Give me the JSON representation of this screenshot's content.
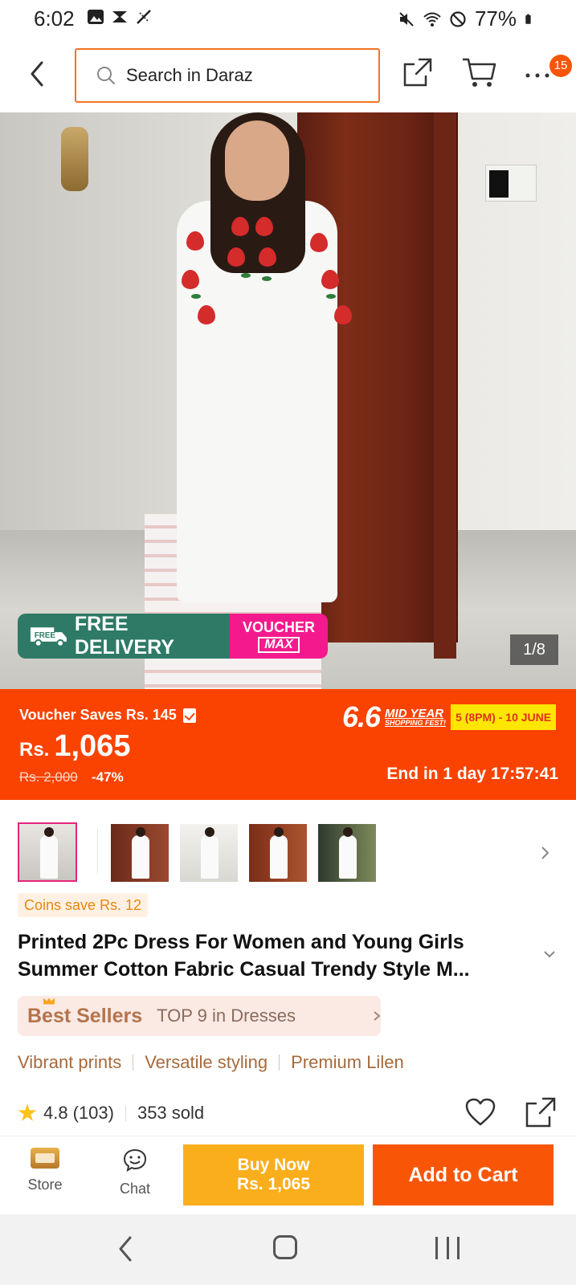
{
  "status_bar": {
    "time": "6:02",
    "battery": "77%",
    "icons": [
      "image-icon",
      "media-icon",
      "no-signal-icon",
      "mute-icon",
      "wifi-icon",
      "dnd-icon",
      "battery-icon"
    ]
  },
  "header": {
    "search_placeholder": "Search in Daraz",
    "notification_count": "15",
    "accent_color": "#f57224"
  },
  "gallery": {
    "counter": "1/8",
    "free_delivery": "FREE DELIVERY",
    "truck_label": "FREE",
    "voucher_top": "VOUCHER",
    "voucher_bottom": "MAX"
  },
  "price_banner": {
    "voucher_saves": "Voucher Saves Rs. 145",
    "currency": "Rs.",
    "price": "1,065",
    "old_price": "Rs. 2,000",
    "discount": "-47%",
    "fest_number": "6.6",
    "fest_line1": "MID YEAR",
    "fest_line2": "SHOPPING FEST!",
    "fest_dates": "5 (8PM) - 10 JUNE",
    "countdown": "End in 1 day 17:57:41",
    "banner_color": "#fa4300"
  },
  "product": {
    "coins": "Coins save Rs. 12",
    "title": "Printed 2Pc Dress For Women and Young Girls Summer Cotton Fabric Casual Trendy Style M...",
    "best_sellers_label": "Best Sellers",
    "best_sellers_rank": "TOP 9 in Dresses",
    "features": [
      "Vibrant prints",
      "Versatile styling",
      "Premium Lilen"
    ],
    "rating": "4.8",
    "reviews": "(103)",
    "sold": "353 sold"
  },
  "actions": {
    "store": "Store",
    "chat": "Chat",
    "buy_now_line1": "Buy Now",
    "buy_now_line2": "Rs. 1,065",
    "add_to_cart": "Add to Cart"
  }
}
